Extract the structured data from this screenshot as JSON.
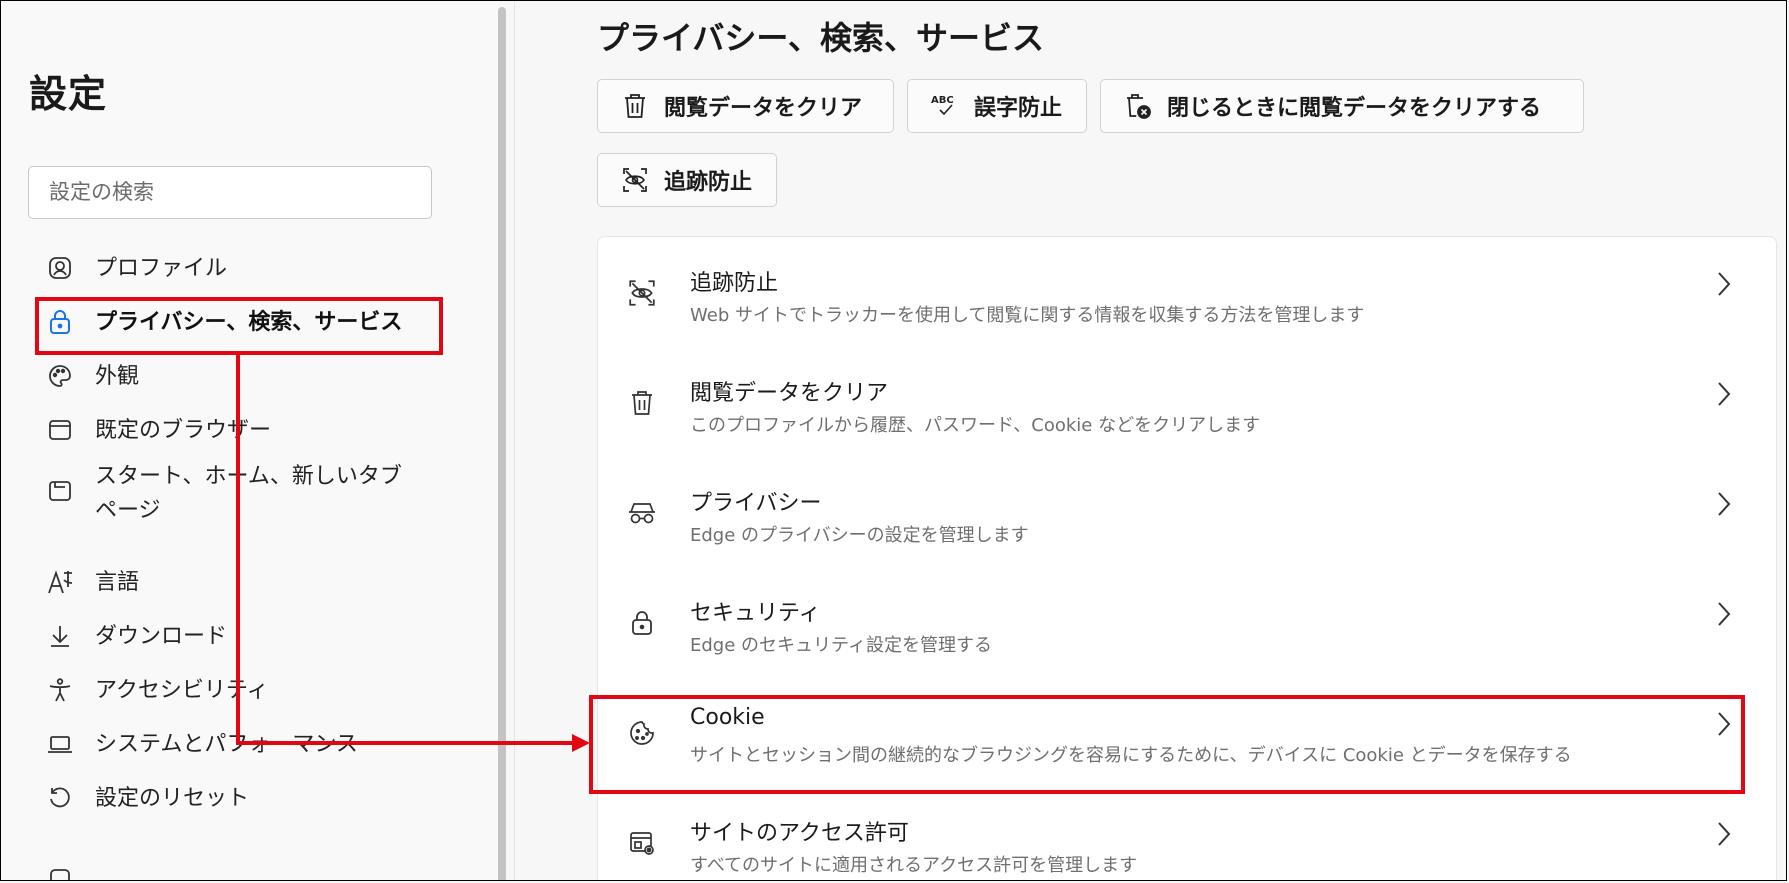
{
  "sidebar": {
    "title": "設定",
    "search_placeholder": "設定の検索",
    "items": [
      {
        "label": "プロファイル",
        "icon": "profile-icon"
      },
      {
        "label": "プライバシー、検索、サービス",
        "icon": "lock-icon",
        "active": true
      },
      {
        "label": "外観",
        "icon": "palette-icon"
      },
      {
        "label": "既定のブラウザー",
        "icon": "browser-icon"
      },
      {
        "label": "スタート、ホーム、新しいタブ",
        "label2": "ページ",
        "icon": "new-tab-icon"
      },
      {
        "label": "言語",
        "icon": "language-icon"
      },
      {
        "label": "ダウンロード",
        "icon": "download-icon"
      },
      {
        "label": "アクセシビリティ",
        "icon": "accessibility-icon"
      },
      {
        "label": "システムとパフォーマンス",
        "icon": "laptop-icon"
      },
      {
        "label": "設定のリセット",
        "icon": "reset-icon"
      }
    ]
  },
  "main": {
    "title": "プライバシー、検索、サービス",
    "quick_buttons": [
      {
        "label": "閲覧データをクリア",
        "icon": "trash-icon"
      },
      {
        "label": "誤字防止",
        "icon": "spellcheck-icon"
      },
      {
        "label": "閉じるときに閲覧データをクリアする",
        "icon": "trash-clock-icon"
      },
      {
        "label": "追跡防止",
        "icon": "tracking-prevention-icon"
      }
    ],
    "rows": [
      {
        "title": "追跡防止",
        "desc": "Web サイトでトラッカーを使用して閲覧に関する情報を収集する方法を管理します",
        "icon": "tracking-prevention-icon"
      },
      {
        "title": "閲覧データをクリア",
        "desc": "このプロファイルから履歴、パスワード、Cookie などをクリアします",
        "icon": "trash-icon"
      },
      {
        "title": "プライバシー",
        "desc": "Edge のプライバシーの設定を管理します",
        "icon": "incognito-icon"
      },
      {
        "title": "セキュリティ",
        "desc": "Edge のセキュリティ設定を管理する",
        "icon": "lock-icon"
      },
      {
        "title": "Cookie",
        "desc": "サイトとセッション間の継続的なブラウジングを容易にするために、デバイスに Cookie とデータを保存する",
        "icon": "cookie-icon"
      },
      {
        "title": "サイトのアクセス許可",
        "desc": "すべてのサイトに適用されるアクセス許可を管理します",
        "icon": "site-permissions-icon"
      }
    ]
  },
  "annotation": {
    "color": "#e30613"
  }
}
